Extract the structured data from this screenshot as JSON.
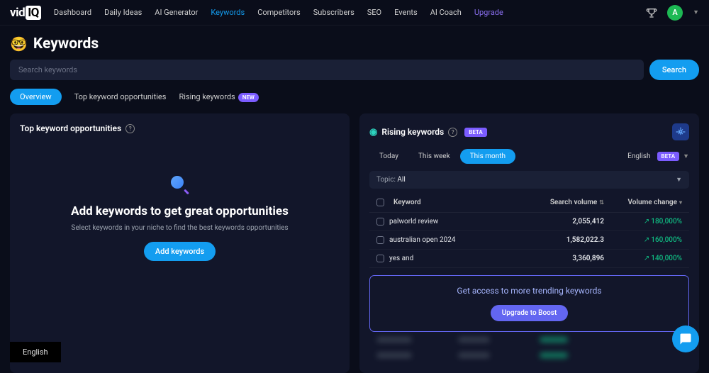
{
  "logo": {
    "a": "vid",
    "b": "IQ"
  },
  "nav": [
    "Dashboard",
    "Daily Ideas",
    "AI Generator",
    "Keywords",
    "Competitors",
    "Subscribers",
    "SEO",
    "Events",
    "AI Coach",
    "Upgrade"
  ],
  "avatar_initial": "A",
  "page_title": "Keywords",
  "page_emoji": "🤓",
  "search": {
    "placeholder": "Search keywords",
    "button": "Search"
  },
  "subtabs": {
    "overview": "Overview",
    "top": "Top keyword opportunities",
    "rising": "Rising keywords",
    "new": "NEW"
  },
  "left": {
    "title": "Top keyword opportunities",
    "empty_title": "Add keywords to get great opportunities",
    "empty_sub": "Select keywords in your niche to find the best keywords opportunities",
    "cta": "Add keywords"
  },
  "right": {
    "title": "Rising keywords",
    "beta": "BETA",
    "periods": [
      "Today",
      "This week",
      "This month"
    ],
    "lang": "English",
    "topic_label": "Topic:",
    "topic_value": "All",
    "cols": {
      "kw": "Keyword",
      "sv": "Search volume",
      "vc": "Volume change"
    },
    "rows": [
      {
        "kw": "palworld review",
        "sv": "2,055,412",
        "vc": "180,000%"
      },
      {
        "kw": "australian open 2024",
        "sv": "1,582,022.3",
        "vc": "160,000%"
      },
      {
        "kw": "yes and",
        "sv": "3,360,896",
        "vc": "140,000%"
      }
    ],
    "upsell_text": "Get access to more trending keywords",
    "upsell_cta": "Upgrade to Boost"
  },
  "footer_lang": "English"
}
